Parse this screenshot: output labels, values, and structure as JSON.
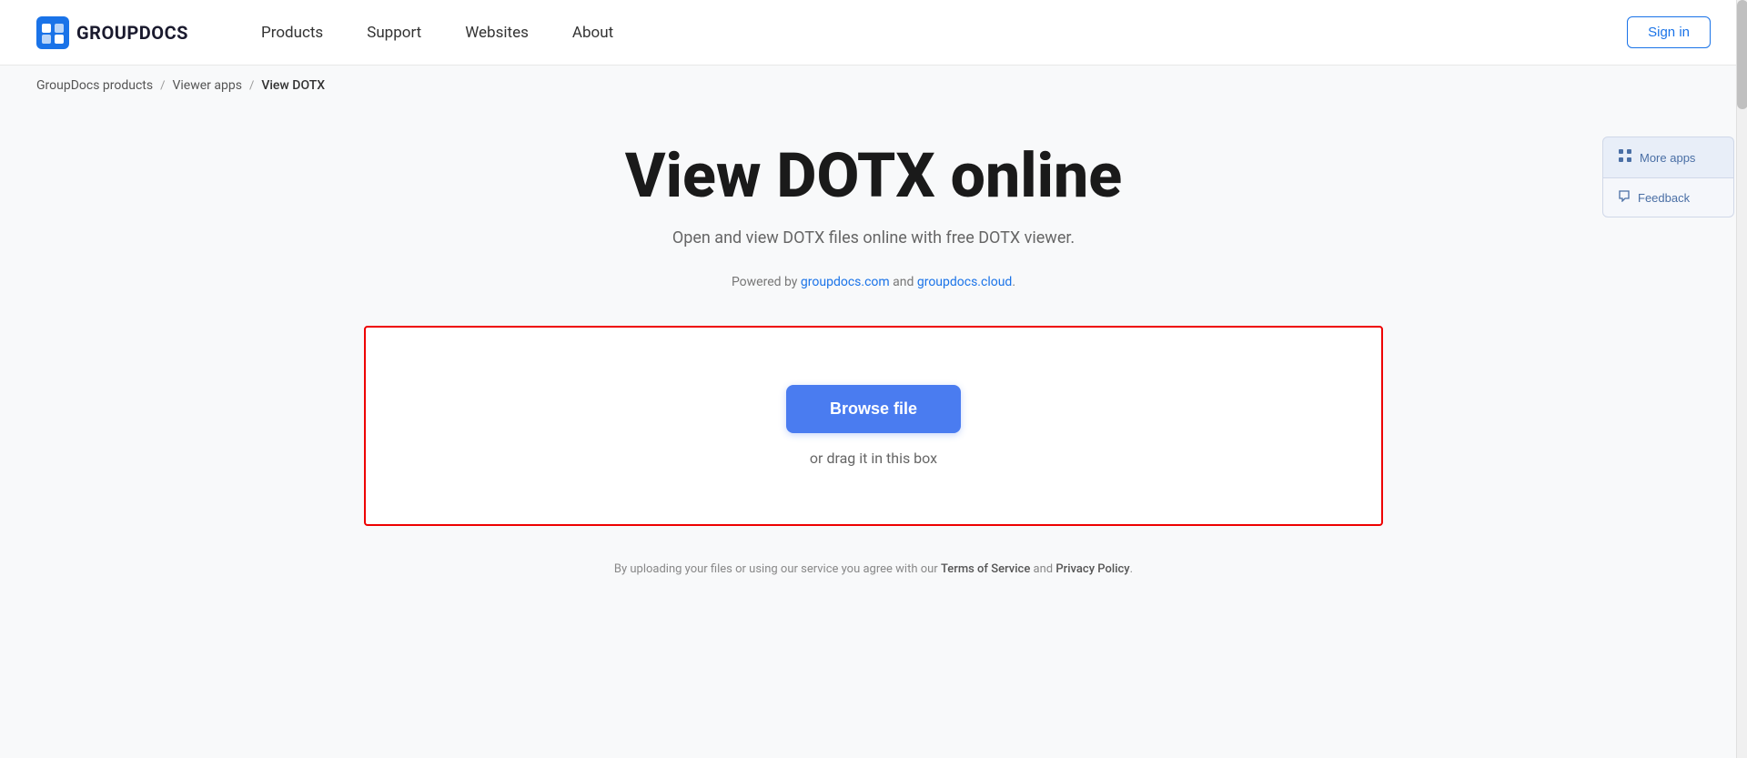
{
  "navbar": {
    "logo_text": "GROUPDOCS",
    "nav_items": [
      {
        "label": "Products",
        "id": "products"
      },
      {
        "label": "Support",
        "id": "support"
      },
      {
        "label": "Websites",
        "id": "websites"
      },
      {
        "label": "About",
        "id": "about"
      }
    ],
    "sign_in_label": "Sign in"
  },
  "breadcrumb": {
    "items": [
      {
        "label": "GroupDocs products",
        "href": "#"
      },
      {
        "label": "Viewer apps",
        "href": "#"
      },
      {
        "label": "View DOTX",
        "href": null
      }
    ]
  },
  "main": {
    "title": "View DOTX online",
    "subtitle": "Open and view DOTX files online with free DOTX viewer.",
    "powered_by_prefix": "Powered by ",
    "powered_by_link1_text": "groupdocs.com",
    "powered_by_link1_href": "#",
    "powered_by_middle": " and ",
    "powered_by_link2_text": "groupdocs.cloud",
    "powered_by_link2_href": "#",
    "powered_by_suffix": ".",
    "browse_btn_label": "Browse file",
    "drag_text": "or drag it in this box",
    "footer_disclaimer_prefix": "By uploading your files or using our service you agree with our ",
    "terms_label": "Terms of Service",
    "footer_disclaimer_middle": " and ",
    "privacy_label": "Privacy Policy",
    "footer_disclaimer_suffix": "."
  },
  "side_buttons": {
    "more_apps_label": "More apps",
    "feedback_label": "Feedback"
  },
  "colors": {
    "accent_blue": "#4a7cf0",
    "border_red": "#ee0000",
    "link_blue": "#1a73e8"
  }
}
